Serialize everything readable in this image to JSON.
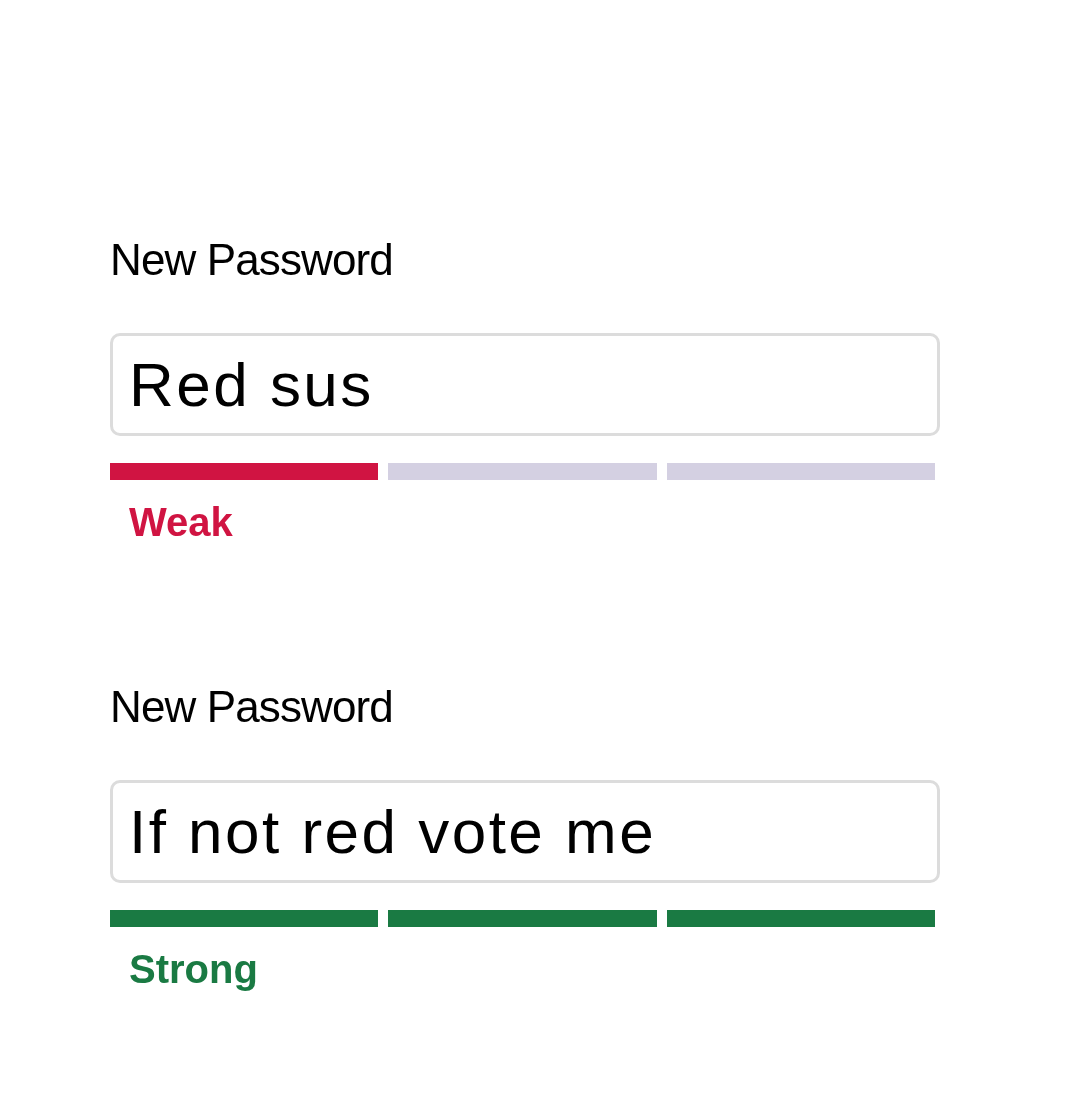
{
  "password_fields": [
    {
      "label": "New Password",
      "value": "Red sus",
      "strength": "Weak",
      "color": "#d01442",
      "segments": [
        {
          "filled": true
        },
        {
          "filled": false
        },
        {
          "filled": false
        }
      ]
    },
    {
      "label": "New Password",
      "value": "If not red vote me",
      "strength": "Strong",
      "color": "#1a7a43",
      "segments": [
        {
          "filled": true
        },
        {
          "filled": true
        },
        {
          "filled": true
        }
      ]
    }
  ]
}
